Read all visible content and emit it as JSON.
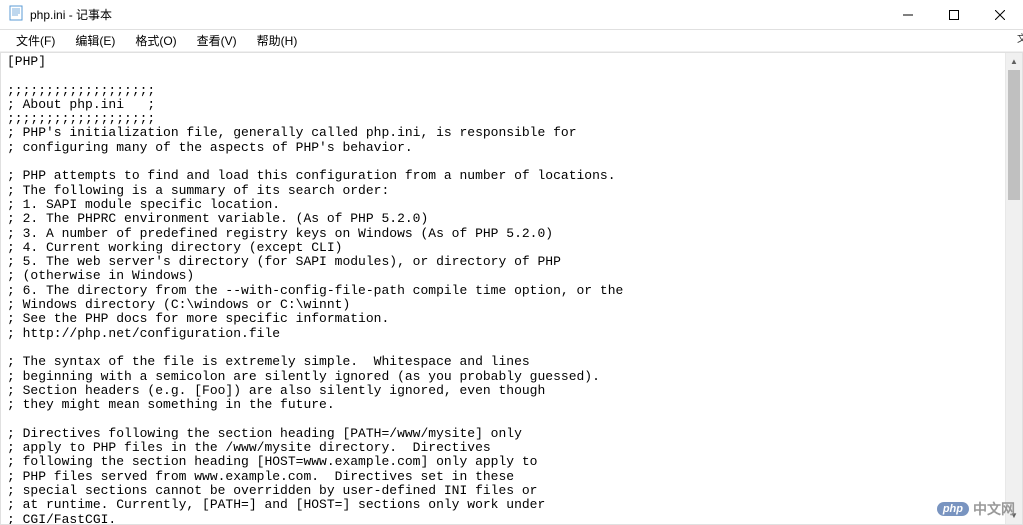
{
  "window": {
    "title": "php.ini - 记事本"
  },
  "menubar": {
    "file": "文件(F)",
    "edit": "编辑(E)",
    "format": "格式(O)",
    "view": "查看(V)",
    "help": "帮助(H)"
  },
  "editor": {
    "content": "[PHP]\n\n;;;;;;;;;;;;;;;;;;;\n; About php.ini   ;\n;;;;;;;;;;;;;;;;;;;\n; PHP's initialization file, generally called php.ini, is responsible for\n; configuring many of the aspects of PHP's behavior.\n\n; PHP attempts to find and load this configuration from a number of locations.\n; The following is a summary of its search order:\n; 1. SAPI module specific location.\n; 2. The PHPRC environment variable. (As of PHP 5.2.0)\n; 3. A number of predefined registry keys on Windows (As of PHP 5.2.0)\n; 4. Current working directory (except CLI)\n; 5. The web server's directory (for SAPI modules), or directory of PHP\n; (otherwise in Windows)\n; 6. The directory from the --with-config-file-path compile time option, or the\n; Windows directory (C:\\windows or C:\\winnt)\n; See the PHP docs for more specific information.\n; http://php.net/configuration.file\n\n; The syntax of the file is extremely simple.  Whitespace and lines\n; beginning with a semicolon are silently ignored (as you probably guessed).\n; Section headers (e.g. [Foo]) are also silently ignored, even though\n; they might mean something in the future.\n\n; Directives following the section heading [PATH=/www/mysite] only\n; apply to PHP files in the /www/mysite directory.  Directives\n; following the section heading [HOST=www.example.com] only apply to\n; PHP files served from www.example.com.  Directives set in these\n; special sections cannot be overridden by user-defined INI files or\n; at runtime. Currently, [PATH=] and [HOST=] sections only work under\n; CGI/FastCGI.\n; http://php.net/ini.sections"
  },
  "watermark": {
    "badge": "php",
    "text": "中文网"
  },
  "right_edge_char": "文"
}
